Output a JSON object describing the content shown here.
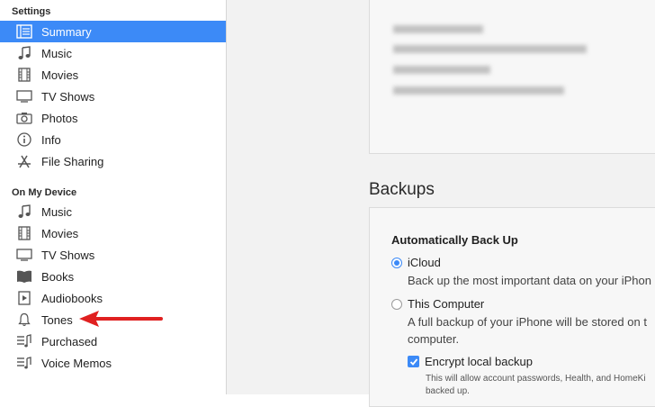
{
  "sidebar": {
    "settings_header": "Settings",
    "settings_items": [
      {
        "label": "Summary",
        "icon": "summary-icon",
        "selected": true
      },
      {
        "label": "Music",
        "icon": "music-note-icon"
      },
      {
        "label": "Movies",
        "icon": "film-icon"
      },
      {
        "label": "TV Shows",
        "icon": "tv-icon"
      },
      {
        "label": "Photos",
        "icon": "camera-icon"
      },
      {
        "label": "Info",
        "icon": "info-icon"
      },
      {
        "label": "File Sharing",
        "icon": "app-store-icon"
      }
    ],
    "device_header": "On My Device",
    "device_items": [
      {
        "label": "Music",
        "icon": "music-note-icon"
      },
      {
        "label": "Movies",
        "icon": "film-icon"
      },
      {
        "label": "TV Shows",
        "icon": "tv-icon"
      },
      {
        "label": "Books",
        "icon": "book-icon"
      },
      {
        "label": "Audiobooks",
        "icon": "audiobook-icon"
      },
      {
        "label": "Tones",
        "icon": "bell-icon"
      },
      {
        "label": "Purchased",
        "icon": "purchased-list-icon"
      },
      {
        "label": "Voice Memos",
        "icon": "voice-memo-icon"
      }
    ]
  },
  "backups": {
    "title": "Backups",
    "auto_backup_title": "Automatically Back Up",
    "icloud_label": "iCloud",
    "icloud_desc": "Back up the most important data on your iPhon",
    "computer_label": "This Computer",
    "computer_desc_1": "A full backup of your iPhone will be stored on t",
    "computer_desc_2": "computer.",
    "encrypt_label": "Encrypt local backup",
    "encrypt_desc_1": "This will allow account passwords, Health, and HomeKi",
    "encrypt_desc_2": "backed up."
  },
  "colors": {
    "accent": "#3c8af7",
    "annotation_arrow": "#e02020"
  }
}
